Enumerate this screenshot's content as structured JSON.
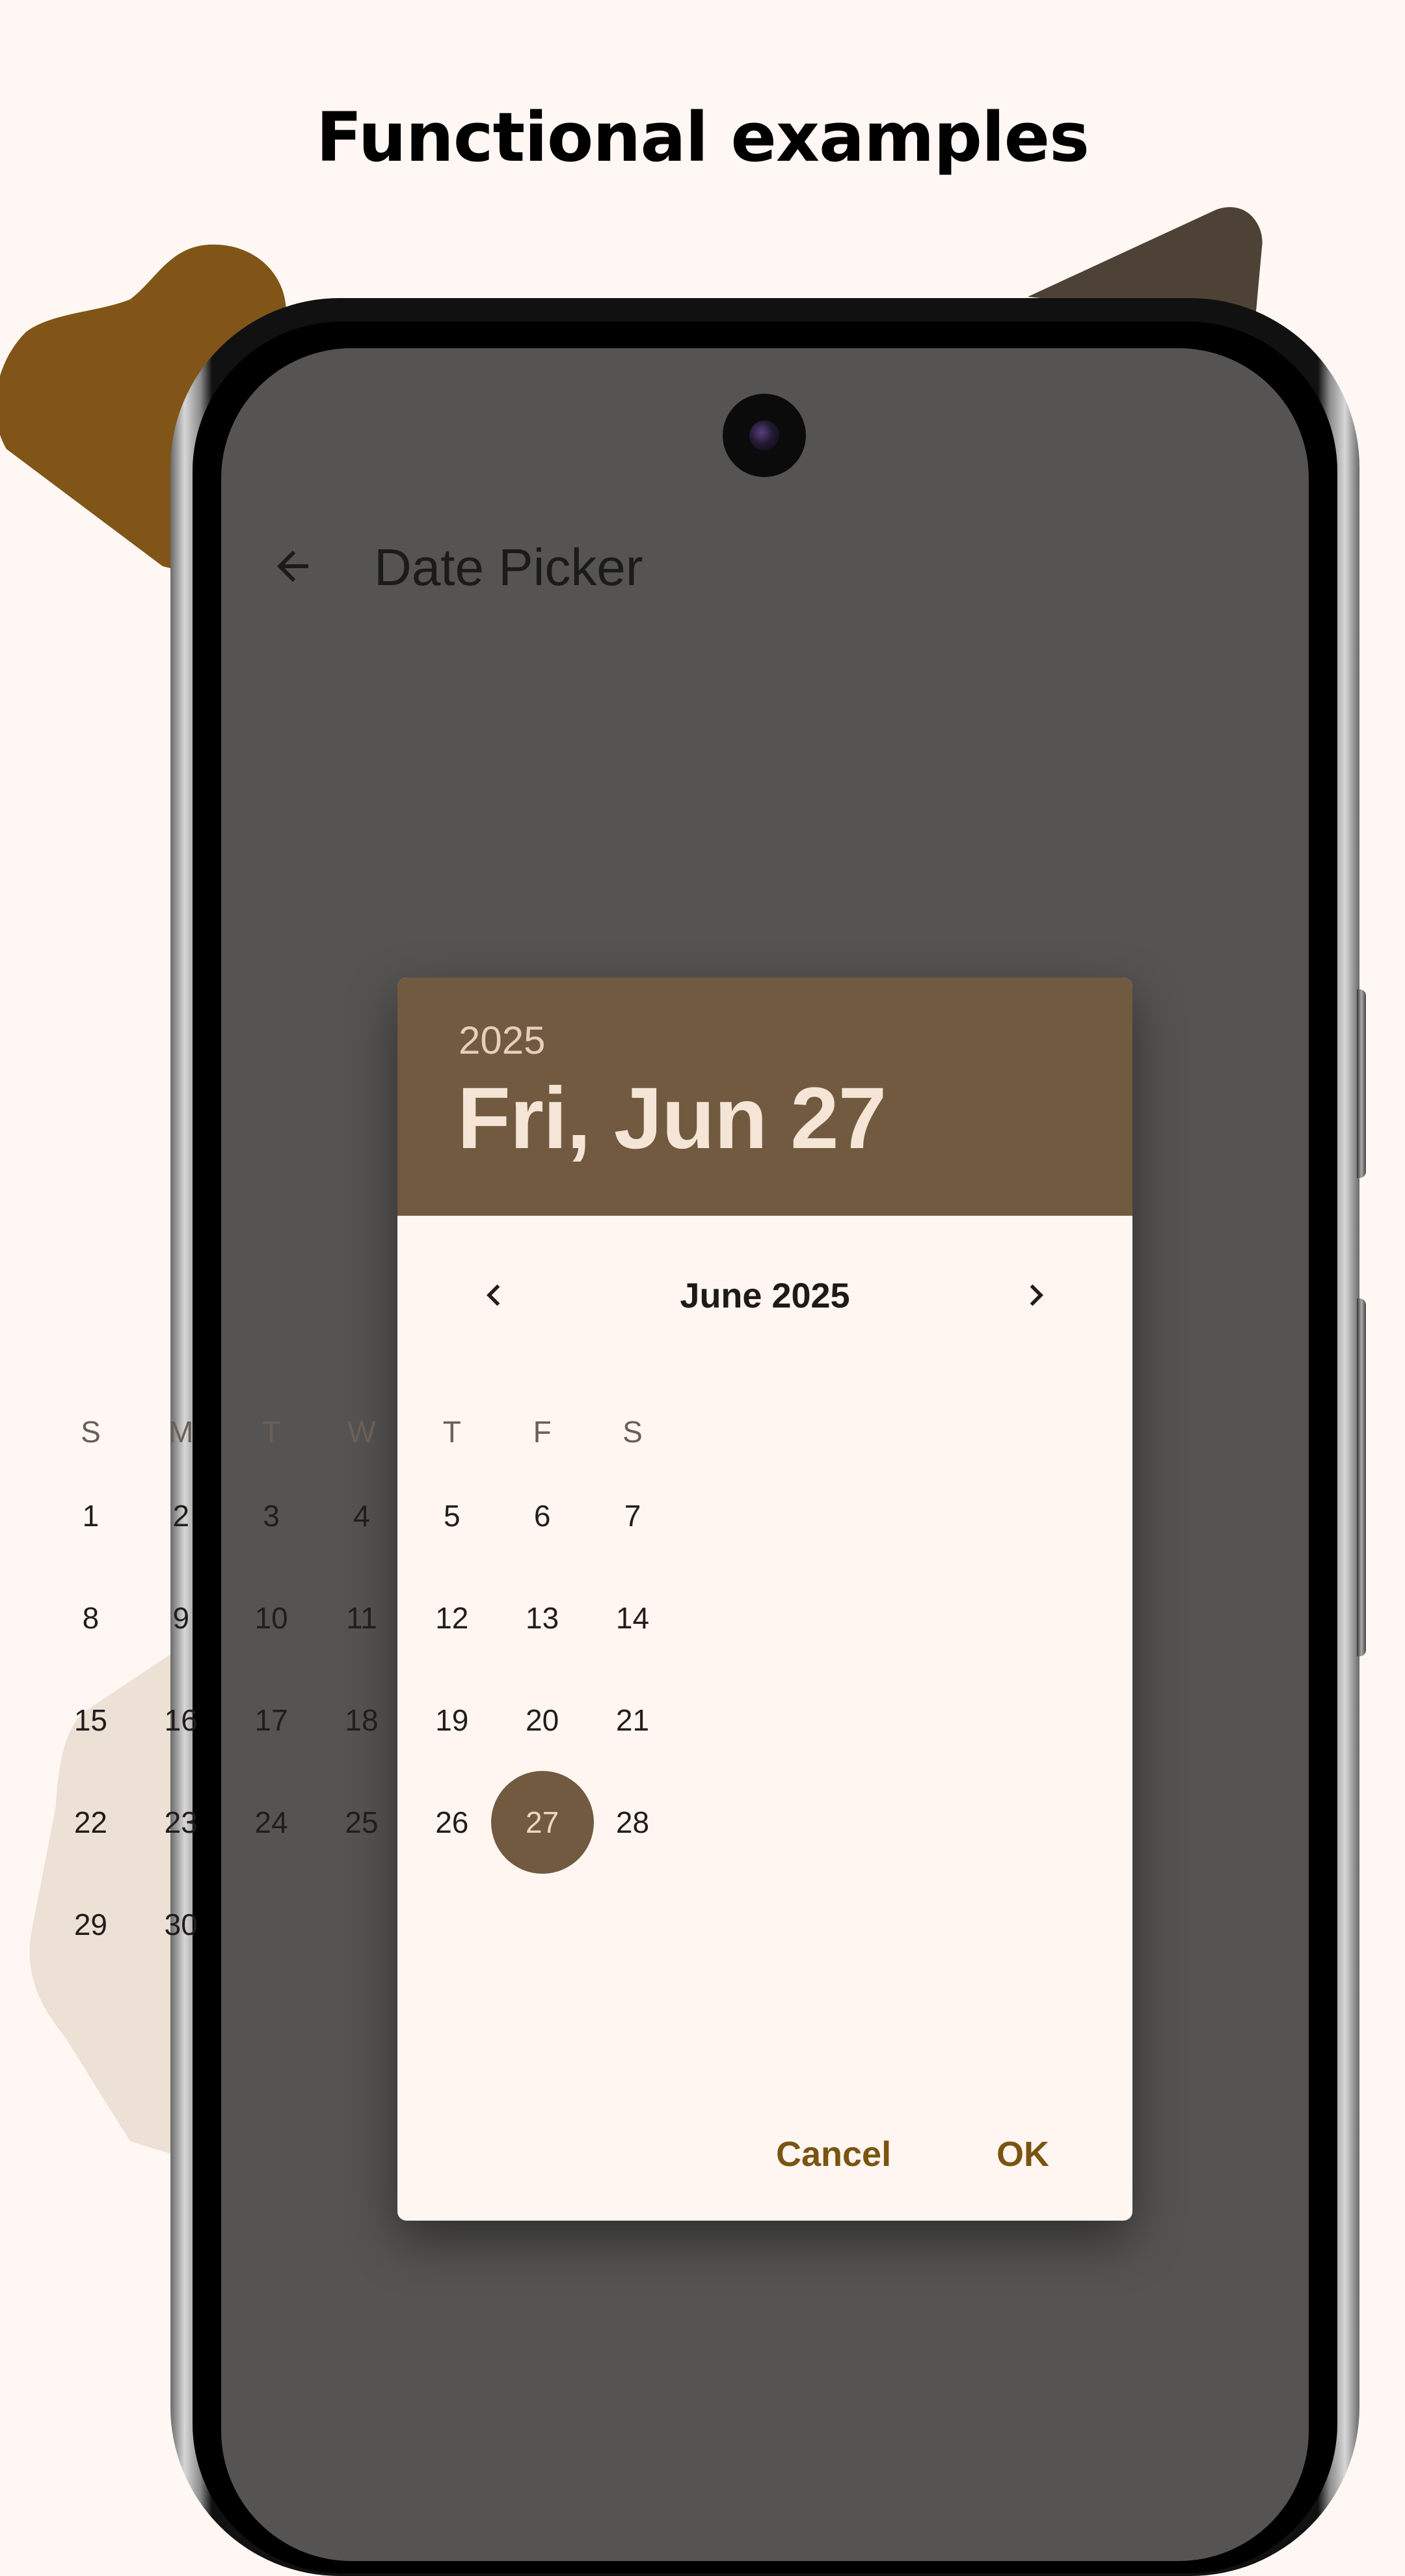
{
  "headline": "Functional examples",
  "app_bar": {
    "back_icon": "arrow-back-icon",
    "title": "Date Picker"
  },
  "date_picker": {
    "header": {
      "year": "2025",
      "selected_date": "Fri, Jun 27"
    },
    "month_label": "June 2025",
    "prev_icon": "chevron-left-icon",
    "next_icon": "chevron-right-icon",
    "weekdays": [
      "S",
      "M",
      "T",
      "W",
      "T",
      "F",
      "S"
    ],
    "days": [
      "1",
      "2",
      "3",
      "4",
      "5",
      "6",
      "7",
      "8",
      "9",
      "10",
      "11",
      "12",
      "13",
      "14",
      "15",
      "16",
      "17",
      "18",
      "19",
      "20",
      "21",
      "22",
      "23",
      "24",
      "25",
      "26",
      "27",
      "28",
      "29",
      "30"
    ],
    "first_day_column": 0,
    "selected_day": "27",
    "cancel_label": "Cancel",
    "ok_label": "OK"
  },
  "colors": {
    "page_background": "#fff7f3",
    "screen_scrim": "#555453",
    "header_background": "#725a40",
    "accent_text": "#7a5512",
    "selected_circle": "#725a40"
  }
}
